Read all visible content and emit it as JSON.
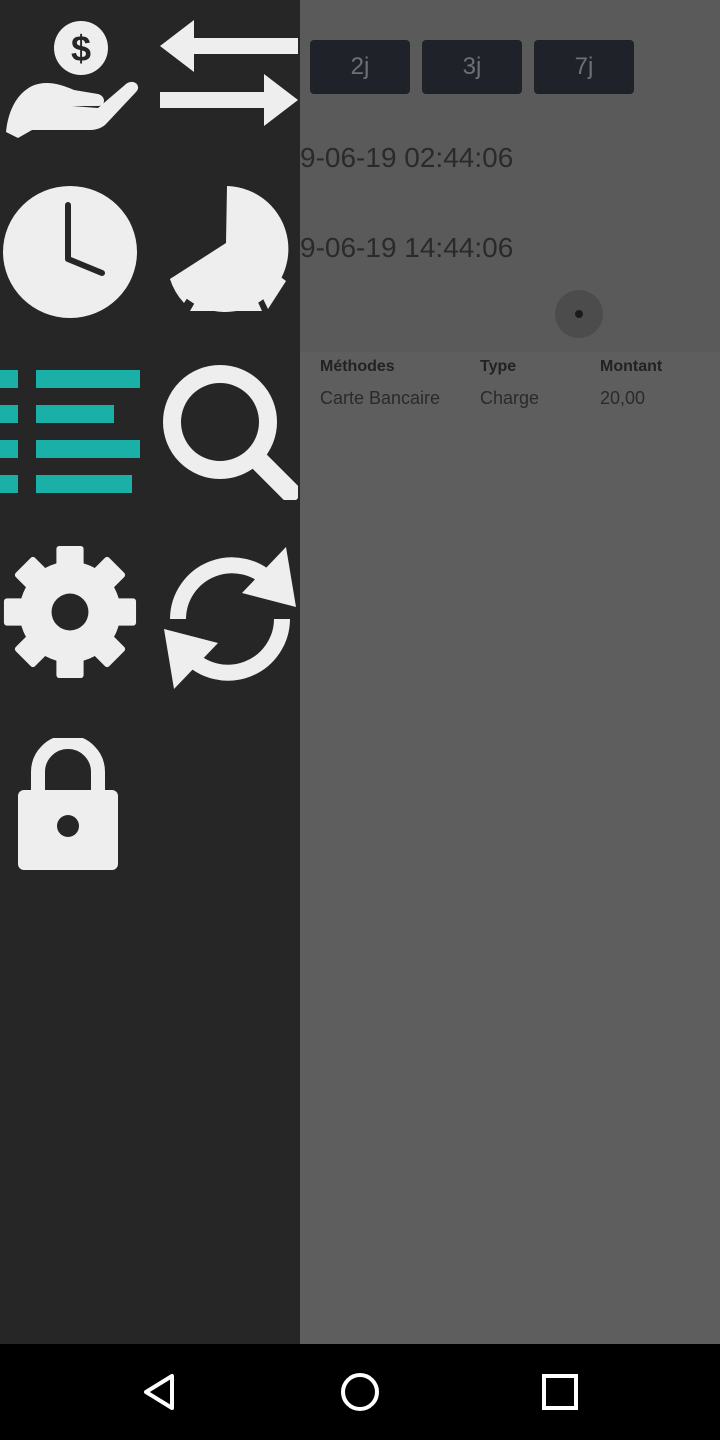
{
  "filters": [
    {
      "label": "2j"
    },
    {
      "label": "3j"
    },
    {
      "label": "7j"
    }
  ],
  "dates": {
    "start": "9-06-19 02:44:06",
    "end": "9-06-19 14:44:06"
  },
  "table": {
    "headers": [
      "Méthodes",
      "Type",
      "Montant"
    ],
    "rows": [
      [
        "Carte Bancaire",
        "Charge",
        "20,00"
      ]
    ]
  },
  "drawer": {
    "icons": [
      "payment-hand-dollar-icon",
      "transfer-arrows-icon",
      "clock-icon",
      "pie-chart-icon",
      "list-icon",
      "search-icon",
      "settings-gear-icon",
      "refresh-icon",
      "lock-icon"
    ],
    "accent_color": "#1ab0a8",
    "icon_color": "#eeeeee"
  },
  "navbar": {
    "icons": [
      "back-icon",
      "home-icon",
      "recents-icon"
    ]
  }
}
